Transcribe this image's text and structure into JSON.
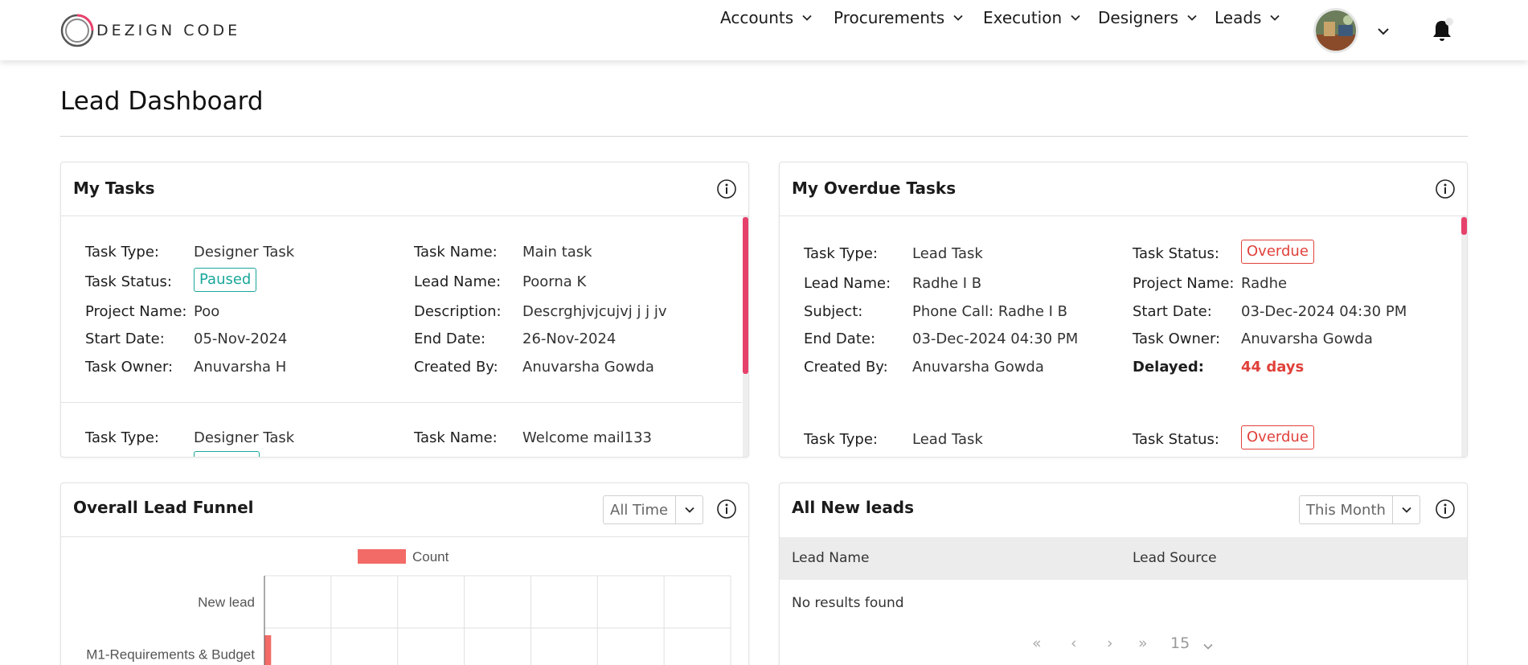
{
  "header": {
    "logo_text": "DEZIGN CODE",
    "nav": [
      "Accounts",
      "Procurements",
      "Execution",
      "Designers",
      "Leads"
    ]
  },
  "page": {
    "title": "Lead Dashboard"
  },
  "my_tasks": {
    "title": "My Tasks",
    "labels": {
      "task_type": "Task Type:",
      "task_status": "Task Status:",
      "project_name": "Project Name:",
      "start_date": "Start Date:",
      "task_owner": "Task Owner:",
      "task_name": "Task Name:",
      "lead_name": "Lead Name:",
      "description": "Description:",
      "end_date": "End Date:",
      "created_by": "Created By:"
    },
    "items": [
      {
        "task_type": "Designer Task",
        "task_status": "Paused",
        "project_name": "Poo",
        "start_date": "05-Nov-2024",
        "task_owner": "Anuvarsha H",
        "task_name": "Main task",
        "lead_name": "Poorna K",
        "description": "Descrghjvjcujvj j j jv",
        "end_date": "26-Nov-2024",
        "created_by": "Anuvarsha Gowda"
      },
      {
        "task_type": "Designer Task",
        "task_name": "Welcome mail133"
      }
    ]
  },
  "overdue": {
    "title": "My Overdue Tasks",
    "labels": {
      "task_type": "Task Type:",
      "lead_name": "Lead Name:",
      "subject": "Subject:",
      "end_date": "End Date:",
      "created_by": "Created By:",
      "task_status": "Task Status:",
      "project_name": "Project Name:",
      "start_date": "Start Date:",
      "task_owner": "Task Owner:",
      "delayed": "Delayed:"
    },
    "items": [
      {
        "task_type": "Lead Task",
        "lead_name": "Radhe I B",
        "subject": "Phone Call: Radhe I B",
        "end_date": "03-Dec-2024 04:30 PM",
        "created_by": "Anuvarsha Gowda",
        "task_status": "Overdue",
        "project_name": "Radhe",
        "start_date": "03-Dec-2024 04:30 PM",
        "task_owner": "Anuvarsha Gowda",
        "delayed": "44 days"
      },
      {
        "task_type": "Lead Task",
        "task_status": "Overdue"
      }
    ]
  },
  "funnel": {
    "title": "Overall Lead Funnel",
    "filter": "All Time"
  },
  "chart_data": {
    "type": "bar",
    "orientation": "horizontal",
    "categories": [
      "New lead",
      "M1-Requirements & Budget"
    ],
    "series": [
      {
        "name": "Count",
        "values": [
          0,
          1
        ],
        "color": "#f26b67"
      }
    ],
    "legend": "top",
    "grid": true
  },
  "new_leads": {
    "title": "All New leads",
    "filter": "This Month",
    "columns": [
      "Lead Name",
      "Lead Source"
    ],
    "empty_text": "No results found",
    "pager": {
      "first": "«",
      "prev": "‹",
      "next": "›",
      "last": "»",
      "page_size": "15"
    }
  }
}
